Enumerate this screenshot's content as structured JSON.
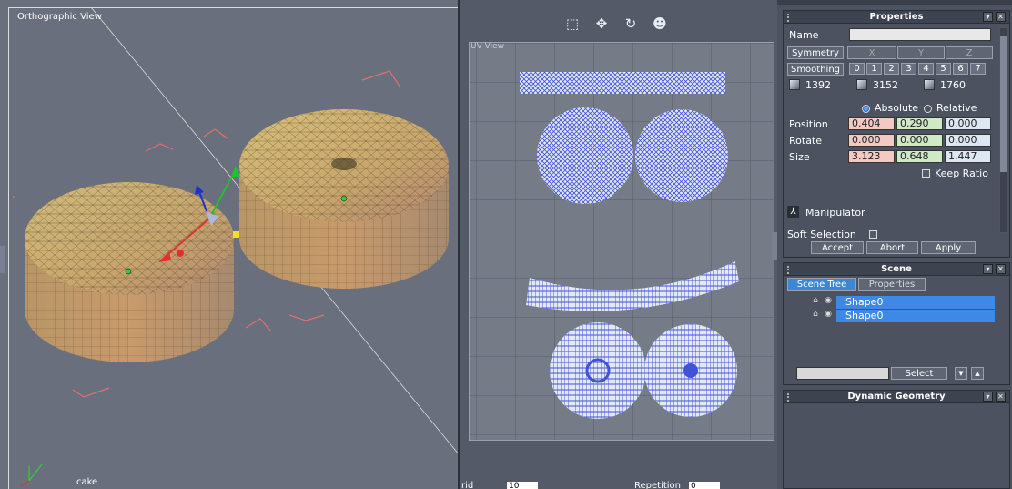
{
  "ortho": {
    "title": "Orthographic View",
    "object_name": "cake"
  },
  "uv": {
    "label": "UV View",
    "tools": [
      "select-vertex-tool-icon",
      "move-tool-icon",
      "rotate-tool-icon",
      "head-view-icon"
    ],
    "bottom": {
      "grid_label": "rid",
      "grid_value": "10",
      "repetition_label": "Repetition",
      "repetition_value": "0"
    }
  },
  "properties": {
    "title": "Properties",
    "name_label": "Name",
    "name_value": "",
    "symmetry_label": "Symmetry",
    "axis_labels": [
      "X",
      "Y",
      "Z"
    ],
    "smoothing_label": "Smoothing",
    "smoothing_levels": [
      "0",
      "1",
      "2",
      "3",
      "4",
      "5",
      "6",
      "7"
    ],
    "counts": [
      "1392",
      "3152",
      "1760"
    ],
    "absolute_label": "Absolute",
    "relative_label": "Relative",
    "position_label": "Position",
    "position": [
      "0.404",
      "0.290",
      "0.000"
    ],
    "rotate_label": "Rotate",
    "rotate": [
      "0.000",
      "0.000",
      "0.000"
    ],
    "size_label": "Size",
    "size": [
      "3.123",
      "0.648",
      "1.447"
    ],
    "keep_ratio_label": "Keep Ratio",
    "manipulator_label": "Manipulator",
    "soft_selection_label": "Soft Selection",
    "accept_label": "Accept",
    "abort_label": "Abort",
    "apply_label": "Apply"
  },
  "scene": {
    "title": "Scene",
    "tabs": [
      "Scene Tree",
      "Properties"
    ],
    "items": [
      "Shape0",
      "Shape0"
    ],
    "search_value": "",
    "select_label": "Select",
    "down_arrow": "▼",
    "up_arrow": "▲"
  },
  "dynamic": {
    "title": "Dynamic Geometry"
  },
  "colors": {
    "accent": "#3f89e6",
    "mesh": "#4a5cd6"
  }
}
